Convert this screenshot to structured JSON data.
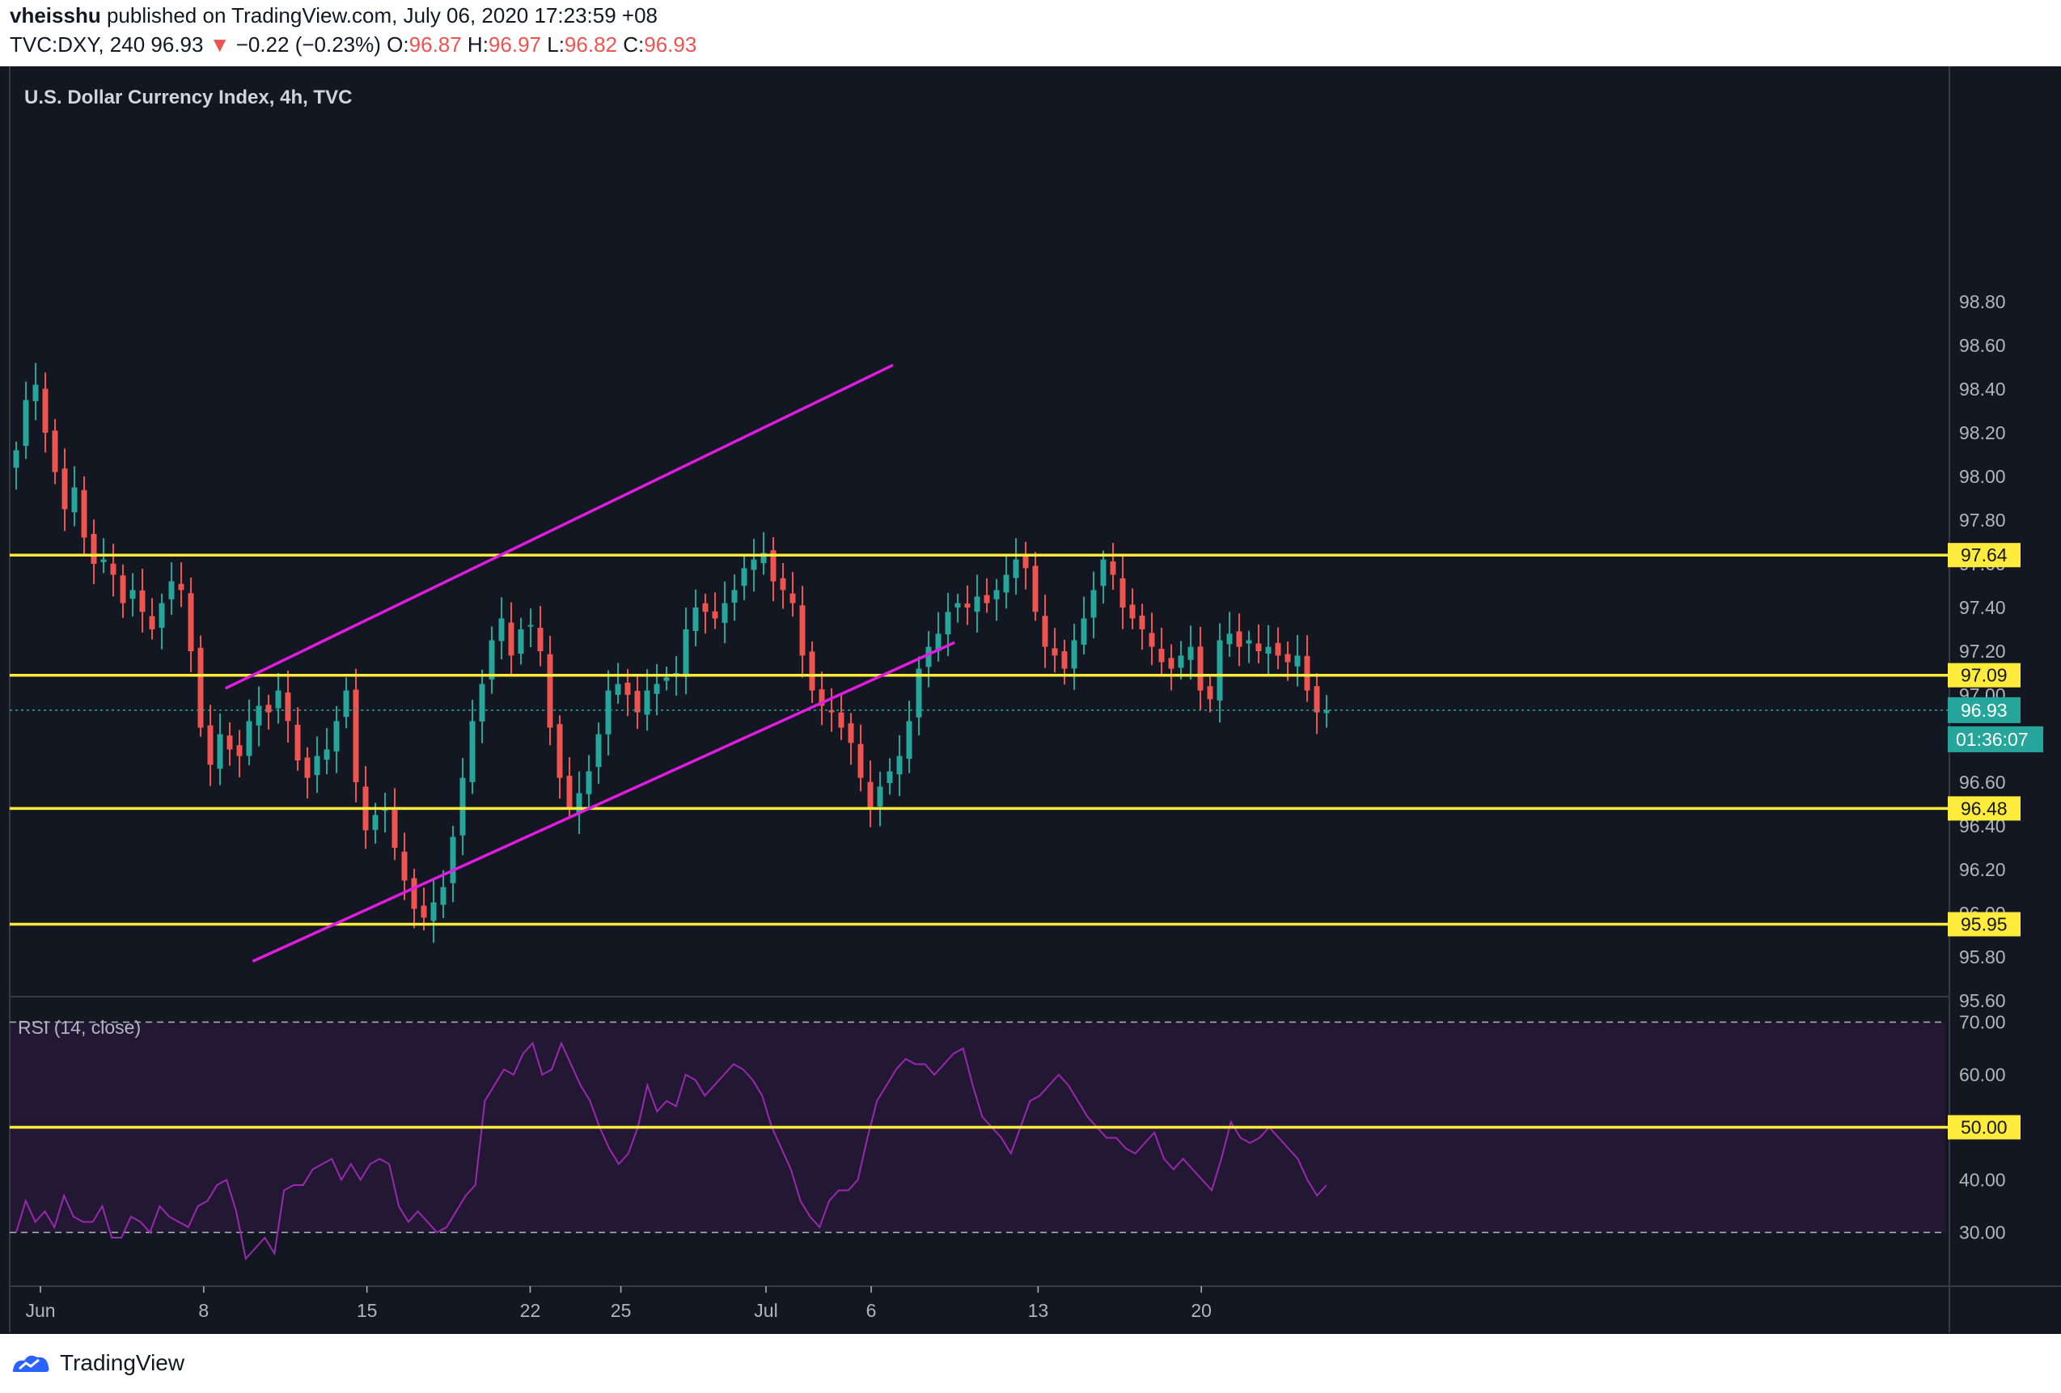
{
  "header": {
    "author": "vheisshu",
    "published_text": "published on TradingView.com, July 06, 2020 17:23:59 +08",
    "symbol": "TVC:DXY, 240",
    "last": "96.93",
    "change": "−0.22 (−0.23%)",
    "open_label": "O:",
    "open": "96.87",
    "high_label": "H:",
    "high": "96.97",
    "low_label": "L:",
    "low": "96.82",
    "close_label": "C:",
    "close": "96.93"
  },
  "footer": {
    "brand": "TradingView"
  },
  "colors": {
    "background": "#131722",
    "rsi_band": "#221833",
    "up": "#26a69a",
    "down": "#ef5350",
    "channel": "#e01ce0",
    "level": "#ffeb3b",
    "rsi_line": "#9c27b0"
  },
  "chart_data": {
    "type": "candlestick",
    "title": "U.S. Dollar Currency Index, 4h, TVC",
    "timeframe": "4h",
    "y_ticks": [
      "98.80",
      "98.60",
      "98.40",
      "98.20",
      "98.00",
      "97.80",
      "97.60",
      "97.40",
      "97.20",
      "97.00",
      "96.80",
      "96.60",
      "96.40",
      "96.20",
      "96.00",
      "95.80",
      "95.60"
    ],
    "ylim": [
      95.45,
      98.85
    ],
    "x_ticks": [
      "Jun",
      "8",
      "15",
      "22",
      "25",
      "Jul",
      "6",
      "13",
      "20"
    ],
    "last_price": "96.93",
    "countdown": "01:36:07",
    "price_levels": [
      "97.64",
      "97.09",
      "96.48",
      "95.95"
    ],
    "channel_lines": [
      {
        "name": "upper",
        "points": [
          [
            "Jun 9",
            97.03
          ],
          [
            "Jul 7",
            98.51
          ]
        ]
      },
      {
        "name": "lower",
        "points": [
          [
            "Jun 11",
            95.78
          ],
          [
            "Jul 9",
            97.24
          ]
        ]
      }
    ],
    "close_path": [
      98.12,
      98.35,
      98.42,
      98.2,
      98.02,
      97.85,
      97.95,
      97.72,
      97.6,
      97.62,
      97.55,
      97.42,
      97.48,
      97.38,
      97.3,
      97.42,
      97.52,
      97.48,
      97.2,
      96.85,
      96.68,
      96.82,
      96.75,
      96.72,
      96.88,
      96.95,
      96.92,
      97.02,
      96.88,
      96.7,
      96.62,
      96.72,
      96.75,
      96.88,
      97.02,
      96.6,
      96.38,
      96.45,
      96.48,
      96.3,
      96.15,
      96.02,
      95.98,
      96.05,
      96.12,
      96.35,
      96.62,
      96.88,
      97.05,
      97.25,
      97.35,
      97.18,
      97.3,
      97.32,
      97.2,
      96.85,
      96.62,
      96.48,
      96.55,
      96.65,
      96.82,
      97.02,
      97.05,
      97.0,
      96.92,
      97.02,
      97.05,
      97.08,
      97.1,
      97.3,
      97.4,
      97.38,
      97.35,
      97.42,
      97.48,
      97.58,
      97.62,
      97.65,
      97.52,
      97.48,
      97.42,
      97.18,
      97.02,
      96.95,
      96.92,
      96.85,
      96.78,
      96.62,
      96.48,
      96.58,
      96.65,
      96.72,
      96.88,
      97.12,
      97.22,
      97.28,
      97.38,
      97.42,
      97.4,
      97.45,
      97.42,
      97.48,
      97.55,
      97.62,
      97.58,
      97.38,
      97.22,
      97.18,
      97.12,
      97.25,
      97.35,
      97.48,
      97.62,
      97.55,
      97.4,
      97.35,
      97.3,
      97.22,
      97.15,
      97.12,
      97.18,
      97.22,
      97.02,
      96.98,
      97.25,
      97.28,
      97.22,
      97.25,
      97.2,
      97.22,
      97.18,
      97.15,
      97.18,
      97.02,
      96.92,
      96.93
    ],
    "rsi": {
      "label": "RSI (14, close)",
      "y_ticks": [
        "70.00",
        "60.00",
        "50.00",
        "40.00",
        "30.00"
      ],
      "ylim": [
        21,
        73
      ],
      "band": [
        30,
        70
      ],
      "level_marker": "50.00",
      "values": [
        30,
        36,
        32,
        34,
        31,
        37,
        33,
        32,
        32,
        35,
        29,
        29,
        33,
        32,
        30,
        35,
        33,
        32,
        31,
        35,
        36,
        39,
        40,
        34,
        25,
        27,
        29,
        26,
        38,
        39,
        39,
        42,
        43,
        44,
        40,
        43,
        40,
        43,
        44,
        43,
        35,
        32,
        34,
        32,
        30,
        31,
        34,
        37,
        39,
        55,
        58,
        61,
        60,
        64,
        66,
        60,
        61,
        66,
        62,
        58,
        55,
        50,
        46,
        43,
        45,
        50,
        58,
        53,
        55,
        54,
        60,
        59,
        56,
        58,
        60,
        62,
        61,
        59,
        56,
        50,
        46,
        42,
        36,
        33,
        31,
        36,
        38,
        38,
        40,
        48,
        55,
        58,
        61,
        63,
        62,
        62,
        60,
        62,
        64,
        65,
        58,
        52,
        50,
        48,
        45,
        50,
        55,
        56,
        58,
        60,
        58,
        55,
        52,
        50,
        48,
        48,
        46,
        45,
        47,
        49,
        44,
        42,
        44,
        42,
        40,
        38,
        44,
        51,
        48,
        47,
        48,
        50,
        48,
        46,
        44,
        40,
        37,
        39
      ]
    }
  }
}
